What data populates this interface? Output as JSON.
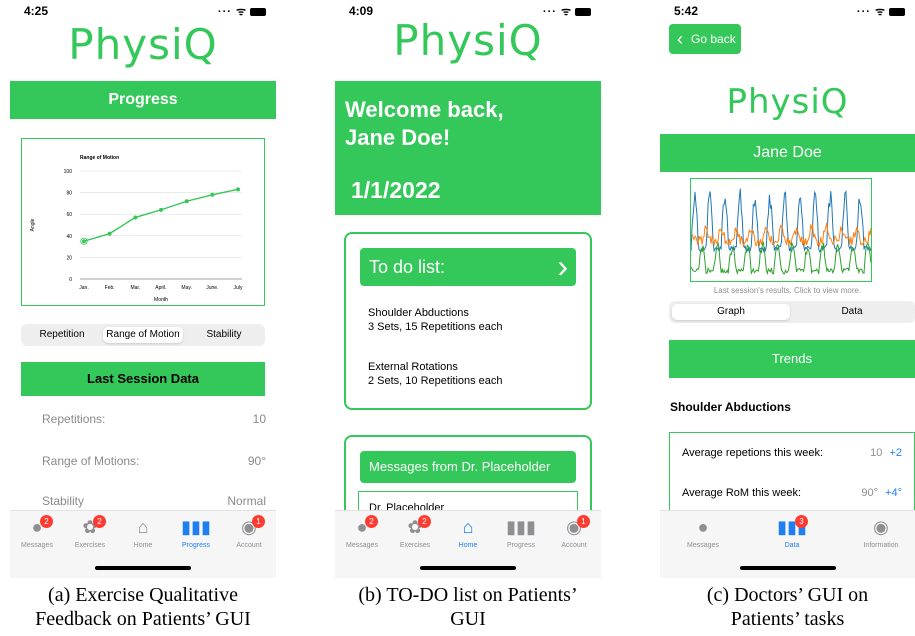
{
  "panel_a": {
    "status": {
      "time": "4:25",
      "signal": "··· ᯤ"
    },
    "logo": "PhysiQ",
    "header": "Progress",
    "chart_data": {
      "type": "line",
      "title": "Range of Motion",
      "xlabel": "Month",
      "ylabel": "Angle",
      "categories": [
        "Jan.",
        "Feb.",
        "Mar.",
        "April.",
        "May.",
        "June.",
        "July"
      ],
      "values": [
        35,
        42,
        57,
        64,
        72,
        78,
        83
      ],
      "ylim": [
        0,
        100
      ],
      "yticks": [
        0,
        20,
        40,
        60,
        80,
        100
      ],
      "grid": true,
      "color": "#34c759"
    },
    "segments": [
      "Repetition",
      "Range of Motion",
      "Stability"
    ],
    "selected_segment": 1,
    "section_title": "Last Session Data",
    "rows": [
      {
        "label": "Repetitions:",
        "value": "10"
      },
      {
        "label": "Range of Motions:",
        "value": "90°"
      },
      {
        "label": "Stability",
        "value": "Normal"
      }
    ],
    "tabs": [
      {
        "label": "Messages",
        "badge": "2"
      },
      {
        "label": "Exercises",
        "badge": "2"
      },
      {
        "label": "Home",
        "badge": ""
      },
      {
        "label": "Progress",
        "badge": ""
      },
      {
        "label": "Account",
        "badge": "1"
      }
    ],
    "caption_line1": "(a) Exercise Qualitative",
    "caption_line2": "Feedback on Patients’ GUI"
  },
  "panel_b": {
    "status": {
      "time": "4:09",
      "signal": "··· ᯤ"
    },
    "logo": "PhysiQ",
    "welcome_line1": "Welcome back,",
    "welcome_line2": "Jane Doe!",
    "date": "1/1/2022",
    "todo_title": "To do list:",
    "todo_chevron": "›",
    "todo_items": [
      {
        "name": "Shoulder Abductions",
        "detail": "3 Sets, 15 Repetitions each"
      },
      {
        "name": "External Rotations",
        "detail": "2 Sets, 10 Repetitions each"
      }
    ],
    "messages_title": "Messages from Dr. Placeholder",
    "message_preview": "Dr. Placeholder",
    "tabs": [
      {
        "label": "Messages",
        "badge": "2"
      },
      {
        "label": "Exercises",
        "badge": "2"
      },
      {
        "label": "Home",
        "badge": ""
      },
      {
        "label": "Progress",
        "badge": ""
      },
      {
        "label": "Account",
        "badge": "1"
      }
    ],
    "caption_line1": "(b) TO-DO list on Patients’",
    "caption_line2": "GUI"
  },
  "panel_c": {
    "status": {
      "time": "5:42",
      "signal": "··· ᯤ"
    },
    "back_label": "Go back",
    "logo": "PhysiQ",
    "patient_name": "Jane Doe",
    "graph_caption": "Last session's results. Click to view more.",
    "segments": [
      "Graph",
      "Data"
    ],
    "selected_segment": 0,
    "trends_title": "Trends",
    "exercise": "Shoulder Abductions",
    "stats": [
      {
        "label": "Average repetions this week:",
        "value": "10",
        "delta": "+2"
      },
      {
        "label": "Average RoM this week:",
        "value": "90°",
        "delta": "+4°"
      }
    ],
    "tabs": [
      {
        "label": "Messages",
        "badge": ""
      },
      {
        "label": "Data",
        "badge": "3"
      },
      {
        "label": "Information",
        "badge": ""
      }
    ],
    "series_colors": [
      "#1f77b4",
      "#ff7f0e",
      "#2ca02c"
    ],
    "caption_line1": "(c) Doctors’ GUI on",
    "caption_line2": "Patients’ tasks"
  },
  "colors": {
    "accent": "#34c759",
    "active_tab": "#1e7ff0",
    "badge": "#ff3b30",
    "link": "#1e7ff0"
  }
}
